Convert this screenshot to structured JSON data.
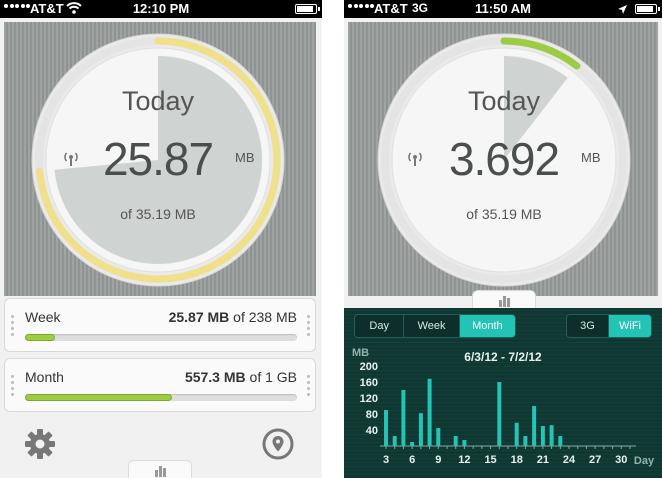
{
  "left": {
    "status": {
      "carrier": "AT&T",
      "time": "12:10 PM"
    },
    "dial": {
      "title": "Today",
      "value": "25.87",
      "unit": "MB",
      "limit_text": "of 35.19 MB",
      "fraction": 0.735,
      "ring_color": "#f0e08a"
    },
    "week": {
      "label": "Week",
      "used": "25.87 MB",
      "limit": "of 238 MB",
      "fraction": 0.11
    },
    "month": {
      "label": "Month",
      "used": "557.3 MB",
      "limit": "of 1 GB",
      "fraction": 0.54
    },
    "icons": {
      "settings": "gear-icon",
      "location": "location-pin-icon"
    }
  },
  "right": {
    "status": {
      "carrier": "AT&T",
      "network": "3G",
      "time": "11:50 AM"
    },
    "dial": {
      "title": "Today",
      "value": "3.692",
      "unit": "MB",
      "limit_text": "of 35.19 MB",
      "fraction": 0.105,
      "ring_color": "#9ccc42"
    },
    "tabs": [
      "Day",
      "Week",
      "Month"
    ],
    "active_tab": "Month",
    "network_tabs": [
      "3G",
      "WiFi"
    ],
    "active_network": "WiFi",
    "range": "6/3/12 - 7/2/12"
  },
  "accent": "#23c3b6",
  "chart_data": {
    "type": "bar",
    "title": "6/3/12 - 7/2/12",
    "ylabel": "MB",
    "xlabel": "Day",
    "ylim": [
      0,
      200
    ],
    "yticks": [
      40,
      80,
      120,
      160,
      200
    ],
    "xticks": [
      3,
      6,
      9,
      12,
      15,
      18,
      21,
      24,
      27,
      30
    ],
    "x": [
      3,
      4,
      5,
      6,
      7,
      8,
      9,
      10,
      11,
      12,
      13,
      14,
      15,
      16,
      17,
      18,
      19,
      20,
      21,
      22,
      23,
      24,
      25,
      26,
      27,
      28,
      29,
      30,
      31
    ],
    "values": [
      90,
      25,
      140,
      10,
      82,
      168,
      45,
      0,
      25,
      15,
      0,
      0,
      0,
      160,
      0,
      58,
      25,
      100,
      50,
      52,
      25,
      0,
      0,
      0,
      0,
      0,
      0,
      0,
      0
    ],
    "bar_color": "#23c3b6"
  }
}
